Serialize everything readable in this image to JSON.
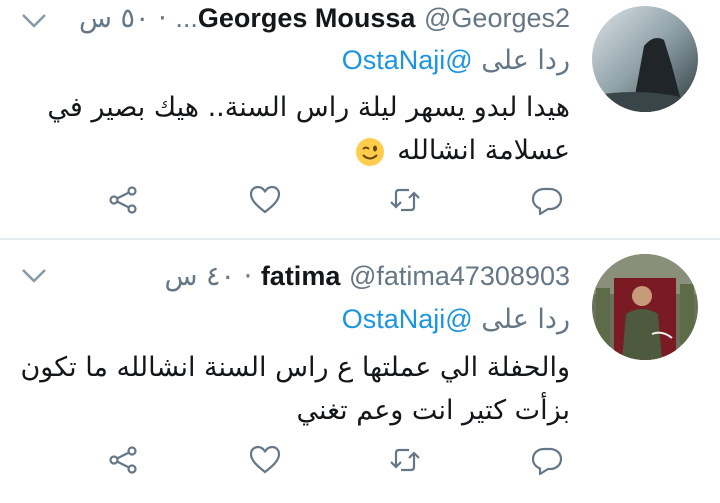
{
  "tweets": [
    {
      "name": "Georges Moussa",
      "handle": "@Georges2...",
      "time": "٥٠ س",
      "reply_prefix": "ردا على",
      "reply_to": "@OstaNaji",
      "text_line1": "هيدا لبدو يسهر ليلة راس السنة.. هيك بصير في",
      "text_line2": "عسلامة انشالله",
      "emoji": "winking-face"
    },
    {
      "name": "fatima",
      "handle": "@fatima47308903",
      "time": "٤٠ س",
      "reply_prefix": "ردا على",
      "reply_to": "@OstaNaji",
      "text_line1": "والحفلة الي عملتها ع راس السنة انشالله ما تكون",
      "text_line2": "بزأت كتير انت وعم تغني"
    }
  ],
  "icons": {
    "menu": "chevron-down-icon",
    "share": "share-icon",
    "like": "heart-icon",
    "retweet": "retweet-icon",
    "reply": "reply-icon"
  },
  "colors": {
    "link": "#1b95e0",
    "muted": "#657786",
    "text": "#14171a",
    "icon": "#657786",
    "separator": "#e6ecf0"
  }
}
